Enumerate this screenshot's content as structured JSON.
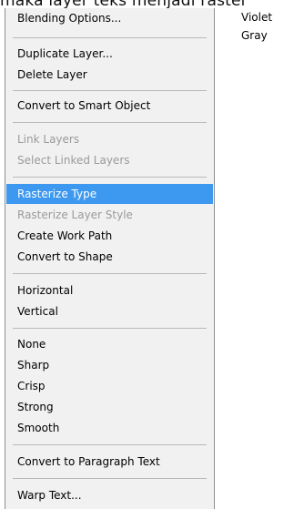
{
  "background_caption": "maka layer teks menjadi raster",
  "menu": {
    "items": [
      {
        "label": "Blending Options...",
        "disabled": false,
        "highlighted": false
      },
      {
        "label": "Duplicate Layer...",
        "disabled": false,
        "highlighted": false
      },
      {
        "label": "Delete Layer",
        "disabled": false,
        "highlighted": false
      },
      {
        "label": "Convert to Smart Object",
        "disabled": false,
        "highlighted": false
      },
      {
        "label": "Link Layers",
        "disabled": true,
        "highlighted": false
      },
      {
        "label": "Select Linked Layers",
        "disabled": true,
        "highlighted": false
      },
      {
        "label": "Rasterize Type",
        "disabled": false,
        "highlighted": true
      },
      {
        "label": "Rasterize Layer Style",
        "disabled": true,
        "highlighted": false
      },
      {
        "label": "Create Work Path",
        "disabled": false,
        "highlighted": false
      },
      {
        "label": "Convert to Shape",
        "disabled": false,
        "highlighted": false
      },
      {
        "label": "Horizontal",
        "disabled": false,
        "highlighted": false
      },
      {
        "label": "Vertical",
        "disabled": false,
        "highlighted": false
      },
      {
        "label": "None",
        "disabled": false,
        "highlighted": false
      },
      {
        "label": "Sharp",
        "disabled": false,
        "highlighted": false
      },
      {
        "label": "Crisp",
        "disabled": false,
        "highlighted": false
      },
      {
        "label": "Strong",
        "disabled": false,
        "highlighted": false
      },
      {
        "label": "Smooth",
        "disabled": false,
        "highlighted": false
      },
      {
        "label": "Convert to Paragraph Text",
        "disabled": false,
        "highlighted": false
      },
      {
        "label": "Warp Text...",
        "disabled": false,
        "highlighted": false
      }
    ]
  },
  "color_labels": [
    "Violet",
    "Gray"
  ],
  "colors": {
    "menu_background": "#f1f1f1",
    "highlight": "#3d98f0",
    "disabled_text": "#9a9a9a",
    "separator": "#b9b9b9"
  }
}
